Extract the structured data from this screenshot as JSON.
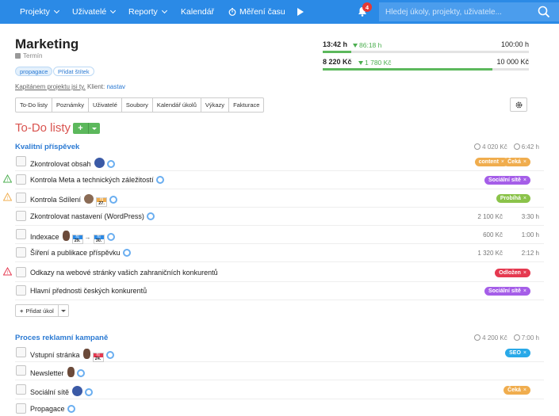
{
  "nav": {
    "items": [
      "Projekty",
      "Uživatelé",
      "Reporty",
      "Kalendář",
      "Měření času"
    ],
    "notifications": "4",
    "search_placeholder": "Hledej úkoly, projekty, uživatele..."
  },
  "project": {
    "title": "Marketing",
    "termin": "Termín",
    "tags": [
      "propagace",
      "Přidat štítek"
    ],
    "captain_text": "Kapitánem projektu jsi ty.",
    "client_label": "Klient:",
    "client_link": "nastav",
    "tabs": [
      "To-Do listy",
      "Poznámky",
      "Uživatelé",
      "Soubory",
      "Kalendář úkolů",
      "Výkazy",
      "Fakturace"
    ]
  },
  "stats": {
    "time_main": "13:42 h",
    "time_delta": "86:18 h",
    "time_total": "100:00 h",
    "time_progress": 0.137,
    "money_main": "8 220 Kč",
    "money_delta": "1 780 Kč",
    "money_total": "10 000 Kč",
    "money_progress": 0.822
  },
  "todo": {
    "title": "To-Do listy",
    "add_task_label": "Přidat úkol"
  },
  "lists": [
    {
      "title": "Kvalitní příspěvek",
      "money": "4 020 Kč",
      "time": "6:42 h",
      "tasks": [
        {
          "name": "Zkontrolovat obsah",
          "badges": [
            {
              "label": "content",
              "color": "#f0ad4e"
            },
            {
              "label": "Čeká",
              "color": "#f0ad4e"
            }
          ]
        },
        {
          "name": "Kontrola Meta a technických záležitostí",
          "badges": [
            {
              "label": "Sociální sítě",
              "color": "#a55ee8"
            }
          ]
        },
        {
          "name": "Kontrola Sdílení",
          "date": "27.",
          "badges": [
            {
              "label": "Probíhá",
              "color": "#8bc34a"
            }
          ]
        },
        {
          "name": "Zkontrolovat nastavení (WordPress)",
          "money": "2 100 Kč",
          "time": "3:30 h"
        },
        {
          "name": "Indexace",
          "date_from": "29.",
          "date_to": "30.",
          "money": "600 Kč",
          "time": "1:00 h"
        },
        {
          "name": "Šíření a publikace příspěvku",
          "money": "1 320 Kč",
          "time": "2:12 h"
        },
        {
          "name": "Odkazy na webové stránky vašich zahraničních konkurentů",
          "badges": [
            {
              "label": "Odložen",
              "color": "#e53950"
            }
          ]
        },
        {
          "name": "Hlavní přednosti českých konkurentů",
          "badges": [
            {
              "label": "Sociální sítě",
              "color": "#a55ee8"
            }
          ]
        }
      ]
    },
    {
      "title": "Proces reklamní kampaně",
      "money": "4 200 Kč",
      "time": "7:00 h",
      "tasks": [
        {
          "name": "Vstupní stránka",
          "date": "24.",
          "badges": [
            {
              "label": "SEO",
              "color": "#29a9e8"
            }
          ]
        },
        {
          "name": "Newsletter"
        },
        {
          "name": "Sociální sítě",
          "badges": [
            {
              "label": "Čeká",
              "color": "#f0ad4e"
            }
          ]
        },
        {
          "name": "Propagace"
        }
      ]
    }
  ],
  "date_month": "říj",
  "colors": {
    "accent": "#2b8ae6",
    "todo_title": "#d9534f",
    "progress": "#5cb85c"
  }
}
